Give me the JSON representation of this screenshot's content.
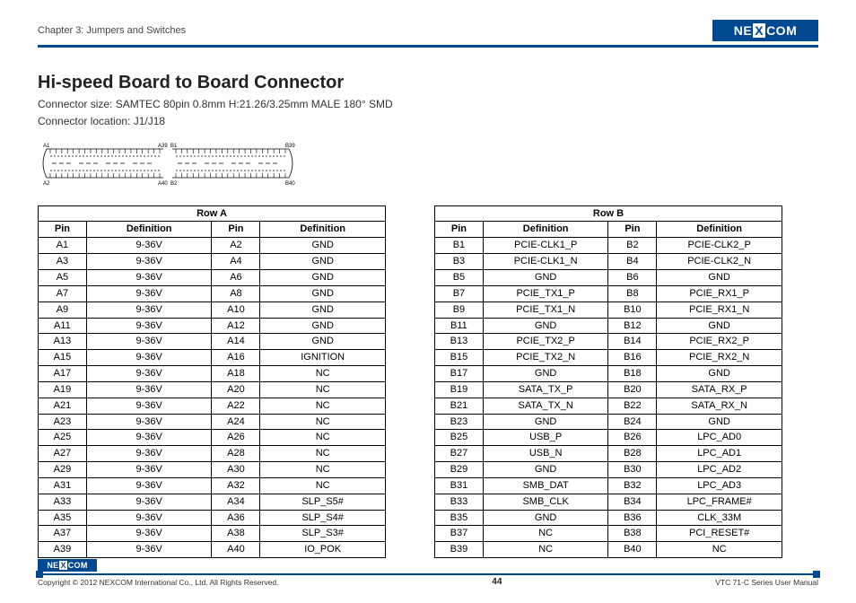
{
  "header": {
    "chapter": "Chapter 3: Jumpers and Switches",
    "brand_left": "NE",
    "brand_mid": "X",
    "brand_right": "COM"
  },
  "main": {
    "title": "Hi-speed Board to Board Connector",
    "spec1": "Connector size: SAMTEC 80pin 0.8mm H:21.26/3.25mm MALE 180° SMD",
    "spec2": "Connector location: J1/J18"
  },
  "diagram_labels": {
    "a1": "A1",
    "a2": "A2",
    "a39": "A39",
    "a40": "A40",
    "b1": "B1",
    "b2": "B2",
    "b39": "B39",
    "b40": "B40"
  },
  "tableA": {
    "group": "Row A",
    "cols": [
      "Pin",
      "Definition",
      "Pin",
      "Definition"
    ],
    "rows": [
      [
        "A1",
        "9-36V",
        "A2",
        "GND"
      ],
      [
        "A3",
        "9-36V",
        "A4",
        "GND"
      ],
      [
        "A5",
        "9-36V",
        "A6",
        "GND"
      ],
      [
        "A7",
        "9-36V",
        "A8",
        "GND"
      ],
      [
        "A9",
        "9-36V",
        "A10",
        "GND"
      ],
      [
        "A11",
        "9-36V",
        "A12",
        "GND"
      ],
      [
        "A13",
        "9-36V",
        "A14",
        "GND"
      ],
      [
        "A15",
        "9-36V",
        "A16",
        "IGNITION"
      ],
      [
        "A17",
        "9-36V",
        "A18",
        "NC"
      ],
      [
        "A19",
        "9-36V",
        "A20",
        "NC"
      ],
      [
        "A21",
        "9-36V",
        "A22",
        "NC"
      ],
      [
        "A23",
        "9-36V",
        "A24",
        "NC"
      ],
      [
        "A25",
        "9-36V",
        "A26",
        "NC"
      ],
      [
        "A27",
        "9-36V",
        "A28",
        "NC"
      ],
      [
        "A29",
        "9-36V",
        "A30",
        "NC"
      ],
      [
        "A31",
        "9-36V",
        "A32",
        "NC"
      ],
      [
        "A33",
        "9-36V",
        "A34",
        "SLP_S5#"
      ],
      [
        "A35",
        "9-36V",
        "A36",
        "SLP_S4#"
      ],
      [
        "A37",
        "9-36V",
        "A38",
        "SLP_S3#"
      ],
      [
        "A39",
        "9-36V",
        "A40",
        "IO_POK"
      ]
    ]
  },
  "tableB": {
    "group": "Row B",
    "cols": [
      "Pin",
      "Definition",
      "Pin",
      "Definition"
    ],
    "rows": [
      [
        "B1",
        "PCIE-CLK1_P",
        "B2",
        "PCIE-CLK2_P"
      ],
      [
        "B3",
        "PCIE-CLK1_N",
        "B4",
        "PCIE-CLK2_N"
      ],
      [
        "B5",
        "GND",
        "B6",
        "GND"
      ],
      [
        "B7",
        "PCIE_TX1_P",
        "B8",
        "PCIE_RX1_P"
      ],
      [
        "B9",
        "PCIE_TX1_N",
        "B10",
        "PCIE_RX1_N"
      ],
      [
        "B11",
        "GND",
        "B12",
        "GND"
      ],
      [
        "B13",
        "PCIE_TX2_P",
        "B14",
        "PCIE_RX2_P"
      ],
      [
        "B15",
        "PCIE_TX2_N",
        "B16",
        "PCIE_RX2_N"
      ],
      [
        "B17",
        "GND",
        "B18",
        "GND"
      ],
      [
        "B19",
        "SATA_TX_P",
        "B20",
        "SATA_RX_P"
      ],
      [
        "B21",
        "SATA_TX_N",
        "B22",
        "SATA_RX_N"
      ],
      [
        "B23",
        "GND",
        "B24",
        "GND"
      ],
      [
        "B25",
        "USB_P",
        "B26",
        "LPC_AD0"
      ],
      [
        "B27",
        "USB_N",
        "B28",
        "LPC_AD1"
      ],
      [
        "B29",
        "GND",
        "B30",
        "LPC_AD2"
      ],
      [
        "B31",
        "SMB_DAT",
        "B32",
        "LPC_AD3"
      ],
      [
        "B33",
        "SMB_CLK",
        "B34",
        "LPC_FRAME#"
      ],
      [
        "B35",
        "GND",
        "B36",
        "CLK_33M"
      ],
      [
        "B37",
        "NC",
        "B38",
        "PCI_RESET#"
      ],
      [
        "B39",
        "NC",
        "B40",
        "NC"
      ]
    ]
  },
  "footer": {
    "copyright": "Copyright © 2012 NEXCOM International Co., Ltd. All Rights Reserved.",
    "page": "44",
    "doc": "VTC 71-C Series User Manual"
  }
}
